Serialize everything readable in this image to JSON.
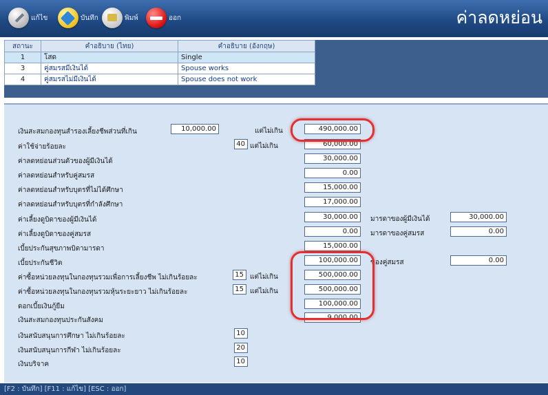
{
  "toolbar": {
    "edit_label": "แก้ไข",
    "save_label": "บันทึก",
    "print_label": "พิมพ์",
    "exit_label": "ออก",
    "screen_title": "ค่าลดหย่อน"
  },
  "status_grid": {
    "headers": [
      "สถานะ",
      "คำอธิบาย (ไทย)",
      "คำอธิบาย (อังกฤษ)"
    ],
    "rows": [
      [
        "1",
        "โสด",
        "Single"
      ],
      [
        "3",
        "คู่สมรสมีเงินได้",
        "Spouse works"
      ],
      [
        "4",
        "คู่สมรสไม่มีเงินได้",
        "Spouse does not work"
      ]
    ]
  },
  "form": {
    "provident_fund_label": "เงินสะสมกองทุนสำรองเลี้ยงชีพส่วนที่เกิน",
    "provident_fund_excess": "10,000.00",
    "not_exceed_label": "แต่ไม่เกิน",
    "provident_fund_max": "490,000.00",
    "expense_pct_label": "ค่าใช้จ่ายร้อยละ",
    "expense_pct": "40",
    "expense_max": "60,000.00",
    "personal_label": "ค่าลดหย่อนส่วนตัวของผู้มีเงินได้",
    "personal": "30,000.00",
    "spouse_label": "ค่าลดหย่อนสำหรับคู่สมรส",
    "spouse": "0.00",
    "child_notstudy_label": "ค่าลดหย่อนสำหรับบุตรที่ไม่ได้ศึกษา",
    "child_notstudy": "15,000.00",
    "child_study_label": "ค่าลดหย่อนสำหรับบุตรที่กำลังศึกษา",
    "child_study": "17,000.00",
    "parent_self_label": "ค่าเลี้ยงดูบิดาของผู้มีเงินได้",
    "parent_self": "30,000.00",
    "mother_self_label": "มารดาของผู้มีเงินได้",
    "mother_self": "30,000.00",
    "parent_spouse_label": "ค่าเลี้ยงดูบิดาของคู่สมรส",
    "parent_spouse": "0.00",
    "mother_spouse_label": "มารดาของคู่สมรส",
    "mother_spouse": "0.00",
    "parent_health_label": "เบี้ยประกันสุขภาพบิดามารดา",
    "parent_health": "15,000.00",
    "life_ins_label": "เบี้ยประกันชีวิต",
    "life_ins": "100,000.00",
    "spouse_life_label": "ของคู่สมรส",
    "spouse_life": "0.00",
    "rmf_label": "ค่าซื้อหน่วยลงทุนในกองทุนรวมเพื่อการเลี้ยงชีพ ไม่เกินร้อยละ",
    "rmf_pct": "15",
    "rmf_max": "500,000.00",
    "ltf_label": "ค่าซื้อหน่วยลงทุนในกองทุนรวมหุ้นระยะยาว ไม่เกินร้อยละ",
    "ltf_pct": "15",
    "ltf_max": "500,000.00",
    "loan_interest_label": "ดอกเบี้ยเงินกู้ยืม",
    "loan_interest": "100,000.00",
    "social_security_label": "เงินสะสมกองทุนประกันสังคม",
    "social_security": "9,000.00",
    "edu_donation_label": "เงินสนับสนุนการศึกษา  ไม่เกินร้อยละ",
    "edu_donation_pct": "10",
    "sport_donation_label": "เงินสนับสนุนการกีฬา  ไม่เกินร้อยละ",
    "sport_donation_pct": "20",
    "donation_label": "เงินบริจาค",
    "donation_pct": "10"
  },
  "statusbar": {
    "text": "[F2 : บันทึก]    [F11 : แก้ไข]    [ESC : ออก]"
  },
  "colors": {
    "toolbar": "#204a85",
    "form_bg": "#d6e4f4",
    "highlight": "#e23030"
  }
}
